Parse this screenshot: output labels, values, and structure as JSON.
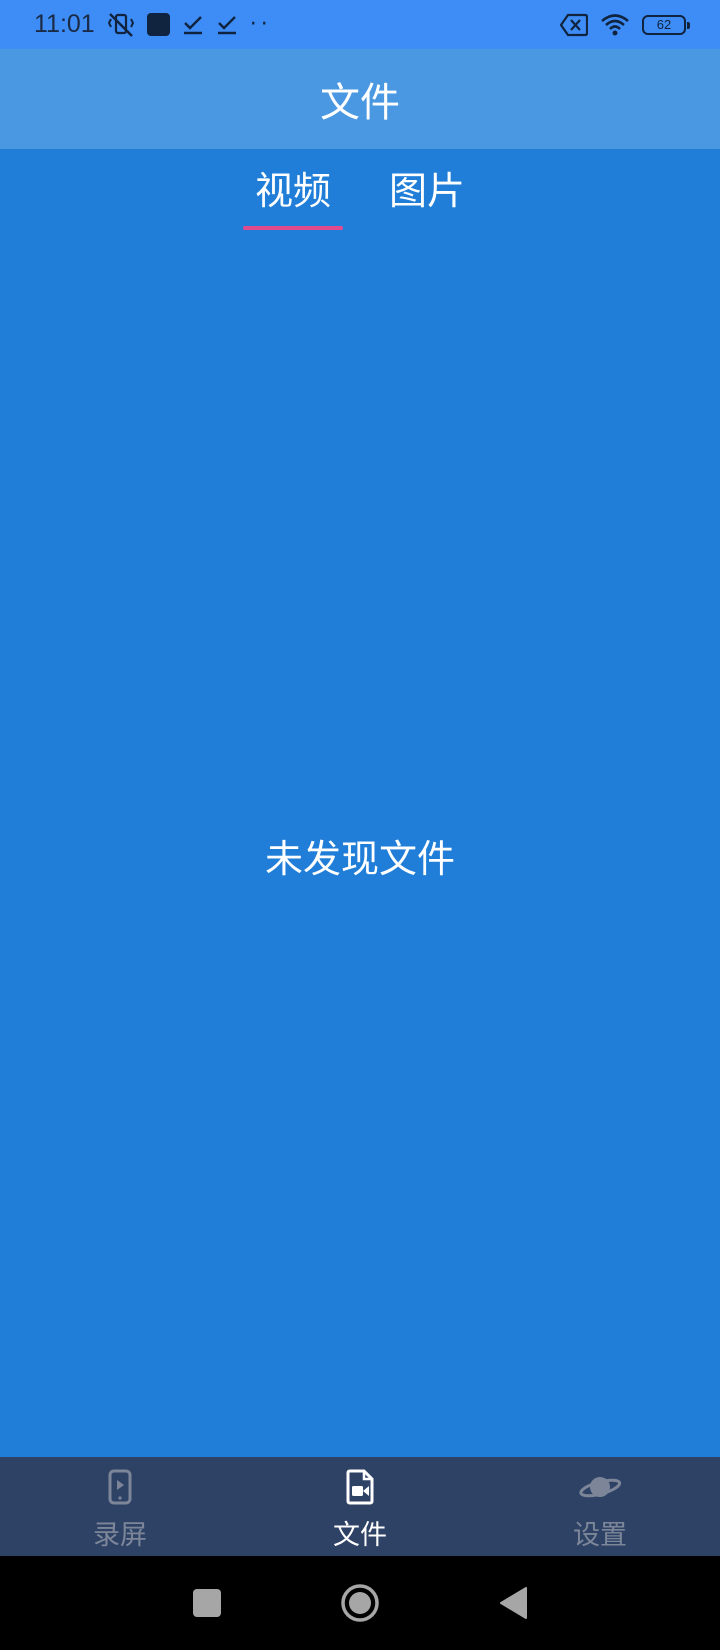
{
  "status_bar": {
    "time": "11:01",
    "battery": "62",
    "icons": [
      "vibrate-off-icon",
      "app-square-icon",
      "download-done-icon",
      "download-done-icon",
      "more-dots-icon",
      "sim-x-icon",
      "wifi-icon",
      "battery-icon"
    ]
  },
  "app_bar": {
    "title": "文件"
  },
  "tabs": [
    {
      "label": "视频",
      "active": true
    },
    {
      "label": "图片",
      "active": false
    }
  ],
  "empty_state": {
    "text": "未发现文件"
  },
  "bottom_nav": {
    "items": [
      {
        "label": "录屏",
        "icon": "phone-record-icon",
        "active": false
      },
      {
        "label": "文件",
        "icon": "video-file-icon",
        "active": true
      },
      {
        "label": "设置",
        "icon": "planet-icon",
        "active": false
      }
    ]
  },
  "system_nav": {
    "buttons": [
      "recents-button",
      "home-button",
      "back-button"
    ]
  },
  "colors": {
    "status_bar": "#3E8DF7",
    "app_bar": "#4A97E2",
    "content": "#207ED9",
    "tab_indicator": "#E24A8E",
    "bottom_nav": "#2E4266",
    "inactive_label": "#7C8698"
  }
}
